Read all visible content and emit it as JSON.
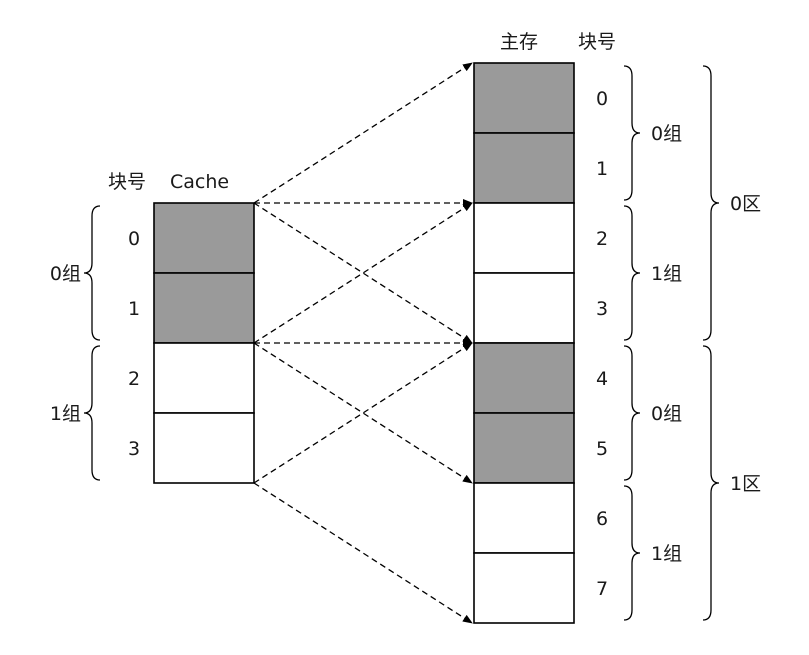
{
  "colors": {
    "shaded": "#9a9a9a",
    "empty": "#ffffff",
    "line": "#000000"
  },
  "cache": {
    "header_index": "块号",
    "header_title": "Cache",
    "blocks": [
      {
        "index": "0",
        "shaded": true
      },
      {
        "index": "1",
        "shaded": true
      },
      {
        "index": "2",
        "shaded": false
      },
      {
        "index": "3",
        "shaded": false
      }
    ],
    "groups": [
      {
        "label": "0组",
        "blocks": [
          0,
          1
        ]
      },
      {
        "label": "1组",
        "blocks": [
          2,
          3
        ]
      }
    ]
  },
  "memory": {
    "header_title": "主存",
    "header_index": "块号",
    "blocks": [
      {
        "index": "0",
        "shaded": true
      },
      {
        "index": "1",
        "shaded": true
      },
      {
        "index": "2",
        "shaded": false
      },
      {
        "index": "3",
        "shaded": false
      },
      {
        "index": "4",
        "shaded": true
      },
      {
        "index": "5",
        "shaded": true
      },
      {
        "index": "6",
        "shaded": false
      },
      {
        "index": "7",
        "shaded": false
      }
    ],
    "groups": [
      {
        "label": "0组",
        "blocks": [
          0,
          1
        ]
      },
      {
        "label": "1组",
        "blocks": [
          2,
          3
        ]
      },
      {
        "label": "0组",
        "blocks": [
          4,
          5
        ]
      },
      {
        "label": "1组",
        "blocks": [
          6,
          7
        ]
      }
    ],
    "zones": [
      {
        "label": "0区",
        "blocks": [
          0,
          3
        ]
      },
      {
        "label": "1区",
        "blocks": [
          4,
          7
        ]
      }
    ]
  },
  "mappings": [
    {
      "from": "cache-top",
      "to": "memory-top"
    },
    {
      "from": "cache-top",
      "to": "memory-group-1"
    },
    {
      "from": "cache-top",
      "to": "memory-group-2"
    },
    {
      "from": "cache-mid",
      "to": "memory-group-1"
    },
    {
      "from": "cache-mid",
      "to": "memory-group-2"
    },
    {
      "from": "cache-mid",
      "to": "memory-group-3"
    },
    {
      "from": "cache-bottom",
      "to": "memory-group-2"
    },
    {
      "from": "cache-bottom",
      "to": "memory-bottom"
    }
  ]
}
